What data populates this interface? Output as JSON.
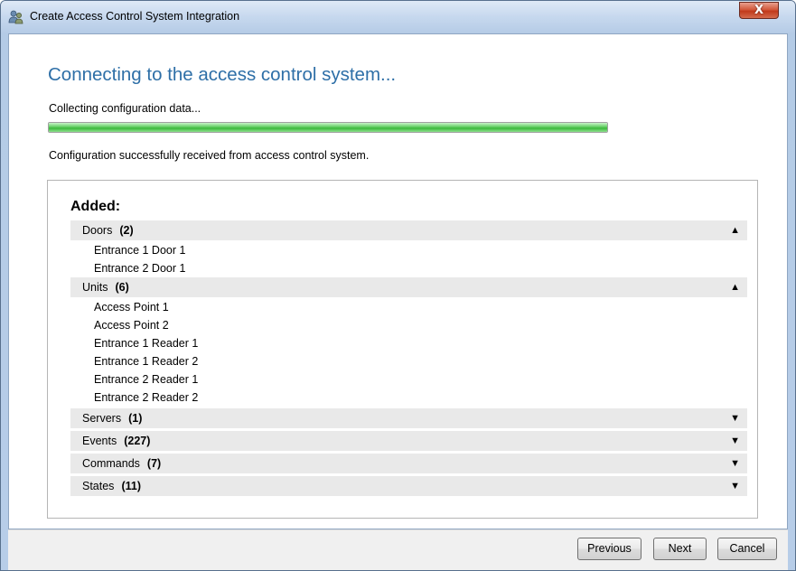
{
  "window": {
    "title": "Create Access Control System Integration",
    "close_label": "X"
  },
  "main": {
    "heading": "Connecting to the access control system...",
    "collecting_label": "Collecting configuration data...",
    "progress_fraction": 1.0,
    "config_status": "Configuration successfully received from access control system."
  },
  "panel": {
    "added_label": "Added:",
    "sections": [
      {
        "name": "Doors",
        "count": "(2)",
        "expanded": true,
        "arrow": "▲",
        "items": [
          "Entrance 1 Door 1",
          "Entrance 2 Door 1"
        ]
      },
      {
        "name": "Units",
        "count": "(6)",
        "expanded": true,
        "arrow": "▲",
        "items": [
          "Access Point 1",
          "Access Point 2",
          "Entrance 1 Reader 1",
          "Entrance 1 Reader 2",
          "Entrance 2 Reader 1",
          "Entrance 2 Reader 2"
        ]
      },
      {
        "name": "Servers",
        "count": "(1)",
        "expanded": false,
        "arrow": "▼",
        "items": []
      },
      {
        "name": "Events",
        "count": "(227)",
        "expanded": false,
        "arrow": "▼",
        "items": []
      },
      {
        "name": "Commands",
        "count": "(7)",
        "expanded": false,
        "arrow": "▼",
        "items": []
      },
      {
        "name": "States",
        "count": "(11)",
        "expanded": false,
        "arrow": "▼",
        "items": []
      }
    ]
  },
  "footer": {
    "previous_label": "Previous",
    "next_label": "Next",
    "cancel_label": "Cancel"
  },
  "colors": {
    "heading": "#2e6fa7",
    "progress_fill": "#3cb93c",
    "section_header_bg": "#e9e9e9",
    "close_button": "#c13a1b"
  },
  "icons": {
    "title_icon": "access-control-users-icon",
    "close": "close-icon",
    "collapse": "triangle-up-icon",
    "expand": "triangle-down-icon"
  }
}
